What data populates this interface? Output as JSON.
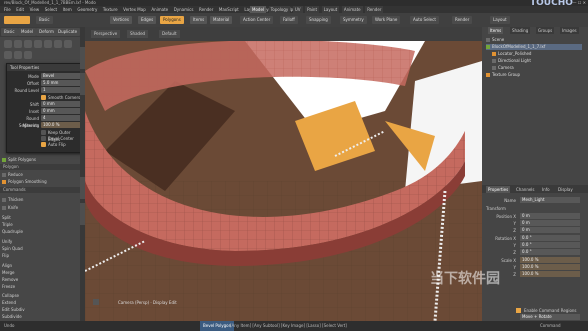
{
  "window": {
    "title": "rev/Block_Of_Modelled_1_1_7BBEm.lxf - Modo",
    "controls": "— ☐ ✕"
  },
  "menu": [
    "File",
    "Edit",
    "View",
    "Select",
    "Item",
    "Geometry",
    "Texture",
    "Vertex Map",
    "Animate",
    "Dynamics",
    "Render",
    "MaxScript",
    "Layout",
    "System",
    "Help"
  ],
  "layout_tabs": [
    {
      "label": "Model",
      "active": true
    },
    {
      "label": "Topology",
      "active": false
    },
    {
      "label": "UV",
      "active": false
    },
    {
      "label": "Paint",
      "active": false
    },
    {
      "label": "Layout",
      "active": false
    },
    {
      "label": "Animate",
      "active": false
    },
    {
      "label": "Render",
      "active": false
    }
  ],
  "brand": "TOUCHO",
  "toolbar": {
    "items": [
      "Vertices",
      "Edges",
      "Polygons",
      "Items",
      "Material",
      "Action Center",
      "Falloff",
      "Snapping",
      "Symmetry",
      "Work Plane",
      "Auto Select"
    ],
    "active": "Polygons"
  },
  "left_tabs": [
    "Basic",
    "Model",
    "Deform",
    "Duplicate",
    "Mesh Edit"
  ],
  "tool_properties": {
    "header": "Tool Properties",
    "rows": [
      {
        "label": "Mode",
        "value": "Bevel"
      },
      {
        "label": "Offset",
        "value": "5.0 mm"
      },
      {
        "label": "Round Level",
        "value": "1"
      },
      {
        "label": "Shift",
        "value": "0 mm"
      },
      {
        "label": "Inset",
        "value": "0 mm"
      },
      {
        "label": "Round Segments",
        "value": "4"
      },
      {
        "label": "Mitering",
        "value": "100.0 %"
      }
    ],
    "checks": [
      {
        "label": "Smooth Corners",
        "on": true
      },
      {
        "label": "Keep Outer Edges",
        "on": false
      },
      {
        "label": "Bevel Center",
        "on": false
      },
      {
        "label": "Auto Flip",
        "on": true
      },
      {
        "label": "Smooth Shift",
        "on": true
      }
    ]
  },
  "left_lower": {
    "polygon_section": "Polygon",
    "items": [
      "Split Polygons",
      "Reduce",
      "Polygon Smoothing",
      "Thicken",
      "Knife",
      "Polygon Bevel",
      "Smooth Shift"
    ],
    "commands_section": "Commands",
    "commands": [
      "Split",
      "Triple",
      "Quadruple",
      "Unify",
      "Spin Quad",
      "Flip",
      "Align",
      "Merge",
      "Remove",
      "Freeze",
      "Collapse",
      "Extend",
      "Edit Subdiv",
      "Subdivide",
      "Set Polygon",
      "Add Loops"
    ]
  },
  "viewport": {
    "tabs": [
      "Perspective",
      "Shaded",
      "Default"
    ],
    "label": "Camera (Persp) · Display Edit",
    "info": "Bevel Polygon",
    "colors": {
      "ring": "#c56a5f",
      "ring_dark": "#8a3d36",
      "floor": "#6b4a36",
      "accent": "#e9a544"
    }
  },
  "right_panel": {
    "tabs": [
      "Items",
      "Shading",
      "Groups",
      "Images"
    ],
    "tree": [
      {
        "label": "Scene",
        "swatch": "",
        "sel": false
      },
      {
        "label": "BlockOfModelled_1_1_7.lxf",
        "swatch": "g",
        "sel": true
      },
      {
        "label": "Locator_Polished",
        "swatch": "o",
        "sel": false
      },
      {
        "label": "Directional Light",
        "swatch": "",
        "sel": false
      },
      {
        "label": "Camera",
        "swatch": "",
        "sel": false
      },
      {
        "label": "Texture Group",
        "swatch": "o",
        "sel": false
      }
    ],
    "prop_tabs": [
      "Properties",
      "Channels",
      "Info",
      "Display"
    ],
    "name_label": "Name",
    "name_value": "Mesh_Light",
    "transform_label": "Transform",
    "props": [
      {
        "label": "Position X",
        "value": "0 m"
      },
      {
        "label": "Y",
        "value": "0 m"
      },
      {
        "label": "Z",
        "value": "0 m"
      },
      {
        "label": "Rotation X",
        "value": "0.0 °"
      },
      {
        "label": "Y",
        "value": "0.0 °"
      },
      {
        "label": "Z",
        "value": "0.0 °"
      },
      {
        "label": "Scale X",
        "value": "100.0 %"
      },
      {
        "label": "Y",
        "value": "100.0 %"
      },
      {
        "label": "Z",
        "value": "100.0 %"
      }
    ],
    "footer_check": "Enable Command Regions",
    "footer_value": "Move + Rotate"
  },
  "status": {
    "left": "Undo",
    "middle": "[Any Item] [Any Subtool] [Key Image] [Lasso] [Select Vert]",
    "right": "Command"
  },
  "watermark": "当下软件园"
}
